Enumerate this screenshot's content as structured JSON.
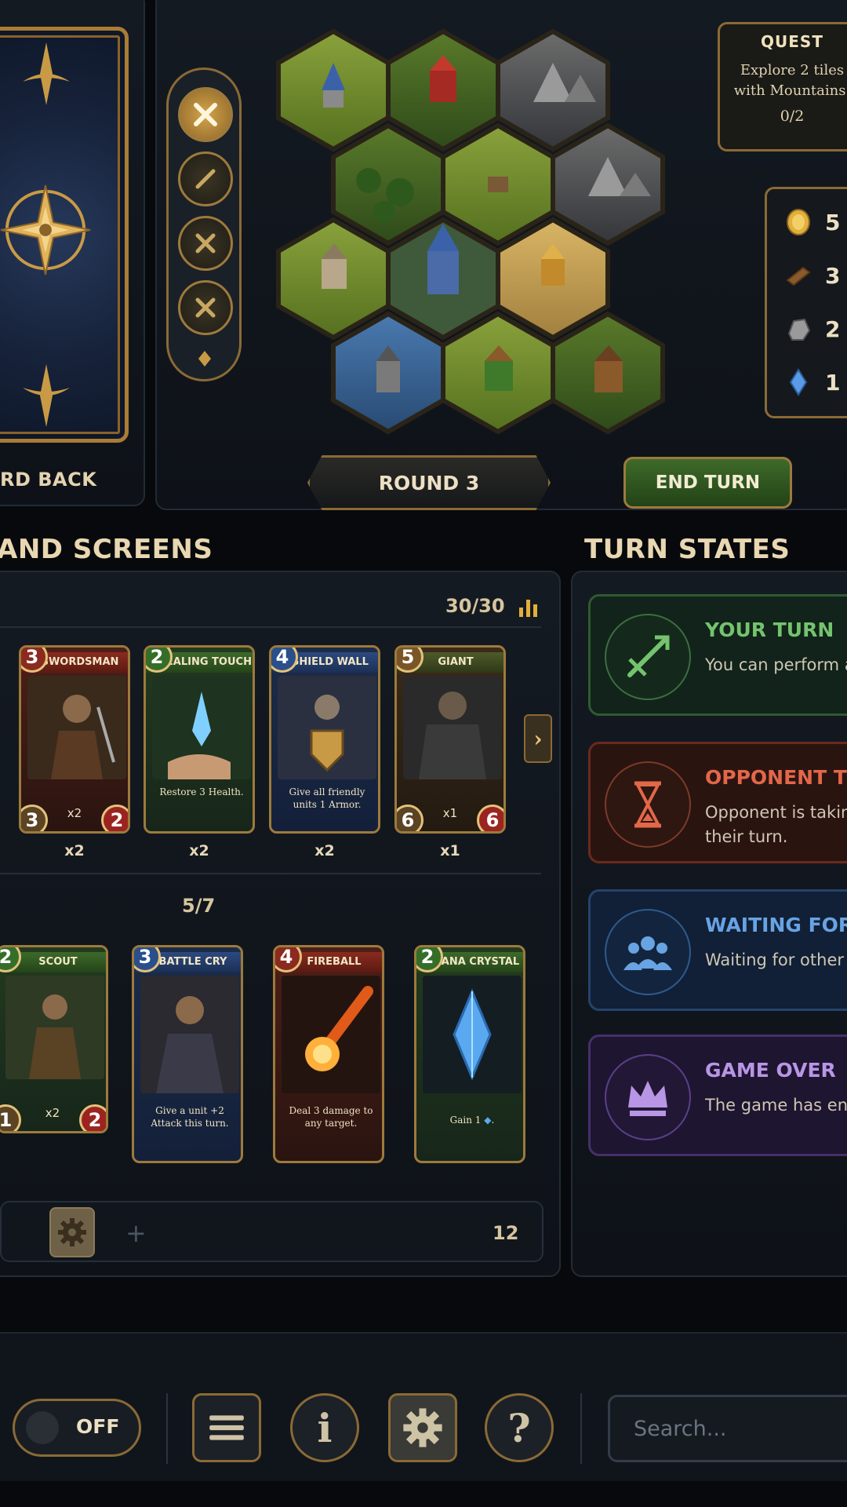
{
  "card_back": {
    "label": "RD BACK"
  },
  "quest": {
    "header": "QUEST",
    "text_line1": "Explore 2 tiles",
    "text_line2": "with Mountains.",
    "progress": "0/2"
  },
  "resources": [
    {
      "icon": "gold-coin-icon",
      "value": "5"
    },
    {
      "icon": "wood-log-icon",
      "value": "3"
    },
    {
      "icon": "stone-ore-icon",
      "value": "2"
    },
    {
      "icon": "mana-crystal-icon",
      "value": "1"
    }
  ],
  "map": {
    "round_label": "ROUND 3",
    "end_turn_label": "END TURN"
  },
  "sections": {
    "hand": "AND SCREENS",
    "turn_states": "TURN STATES"
  },
  "hand": {
    "deck_count": "30/30",
    "hand_count": "5/7",
    "footer_count": "12",
    "deck_cards": [
      {
        "name": "SWORDSMAN",
        "cost": "3",
        "attack": "3",
        "health": "2",
        "multiplier": "x2",
        "quantity": "x2",
        "color": "red"
      },
      {
        "name": "HEALING TOUCH",
        "cost": "2",
        "description": "Restore 3 Health.",
        "quantity": "x2",
        "color": "green"
      },
      {
        "name": "SHIELD WALL",
        "cost": "4",
        "description": "Give all friendly units 1 Armor.",
        "quantity": "x2",
        "color": "blue"
      },
      {
        "name": "GIANT",
        "cost": "5",
        "attack": "6",
        "health": "6",
        "multiplier": "x1",
        "quantity": "x1",
        "color": "olive"
      }
    ],
    "hand_cards": [
      {
        "name": "SCOUT",
        "cost": "2",
        "attack": "1",
        "health": "2",
        "multiplier": "x2",
        "color": "green"
      },
      {
        "name": "BATTLE CRY",
        "cost": "3",
        "description": "Give a unit +2 Attack this turn.",
        "color": "blue"
      },
      {
        "name": "FIREBALL",
        "cost": "4",
        "description": "Deal 3 damage to any target.",
        "color": "red"
      },
      {
        "name": "MANA CRYSTAL",
        "cost": "2",
        "description": "Gain 1",
        "color": "green"
      }
    ]
  },
  "turn_states": [
    {
      "title": "YOUR TURN",
      "description": "You can perform a",
      "icon": "crossed-swords-icon",
      "color": "#74c36e"
    },
    {
      "title": "OPPONENT TU",
      "description": "Opponent is takin\ntheir turn.",
      "icon": "hourglass-icon",
      "color": "#e3674a"
    },
    {
      "title": "WAITING FOR",
      "description": "Waiting for other",
      "icon": "group-icon",
      "color": "#68a3e4"
    },
    {
      "title": "GAME OVER",
      "description": "The game has en",
      "icon": "crown-icon",
      "color": "#b995e6"
    }
  ],
  "toolbar": {
    "toggle_label": "OFF",
    "info_glyph": "i",
    "help_glyph": "?",
    "search_placeholder": "Search..."
  },
  "colors": {
    "accent_gold": "#9d7a3c",
    "background": "#07090c"
  }
}
